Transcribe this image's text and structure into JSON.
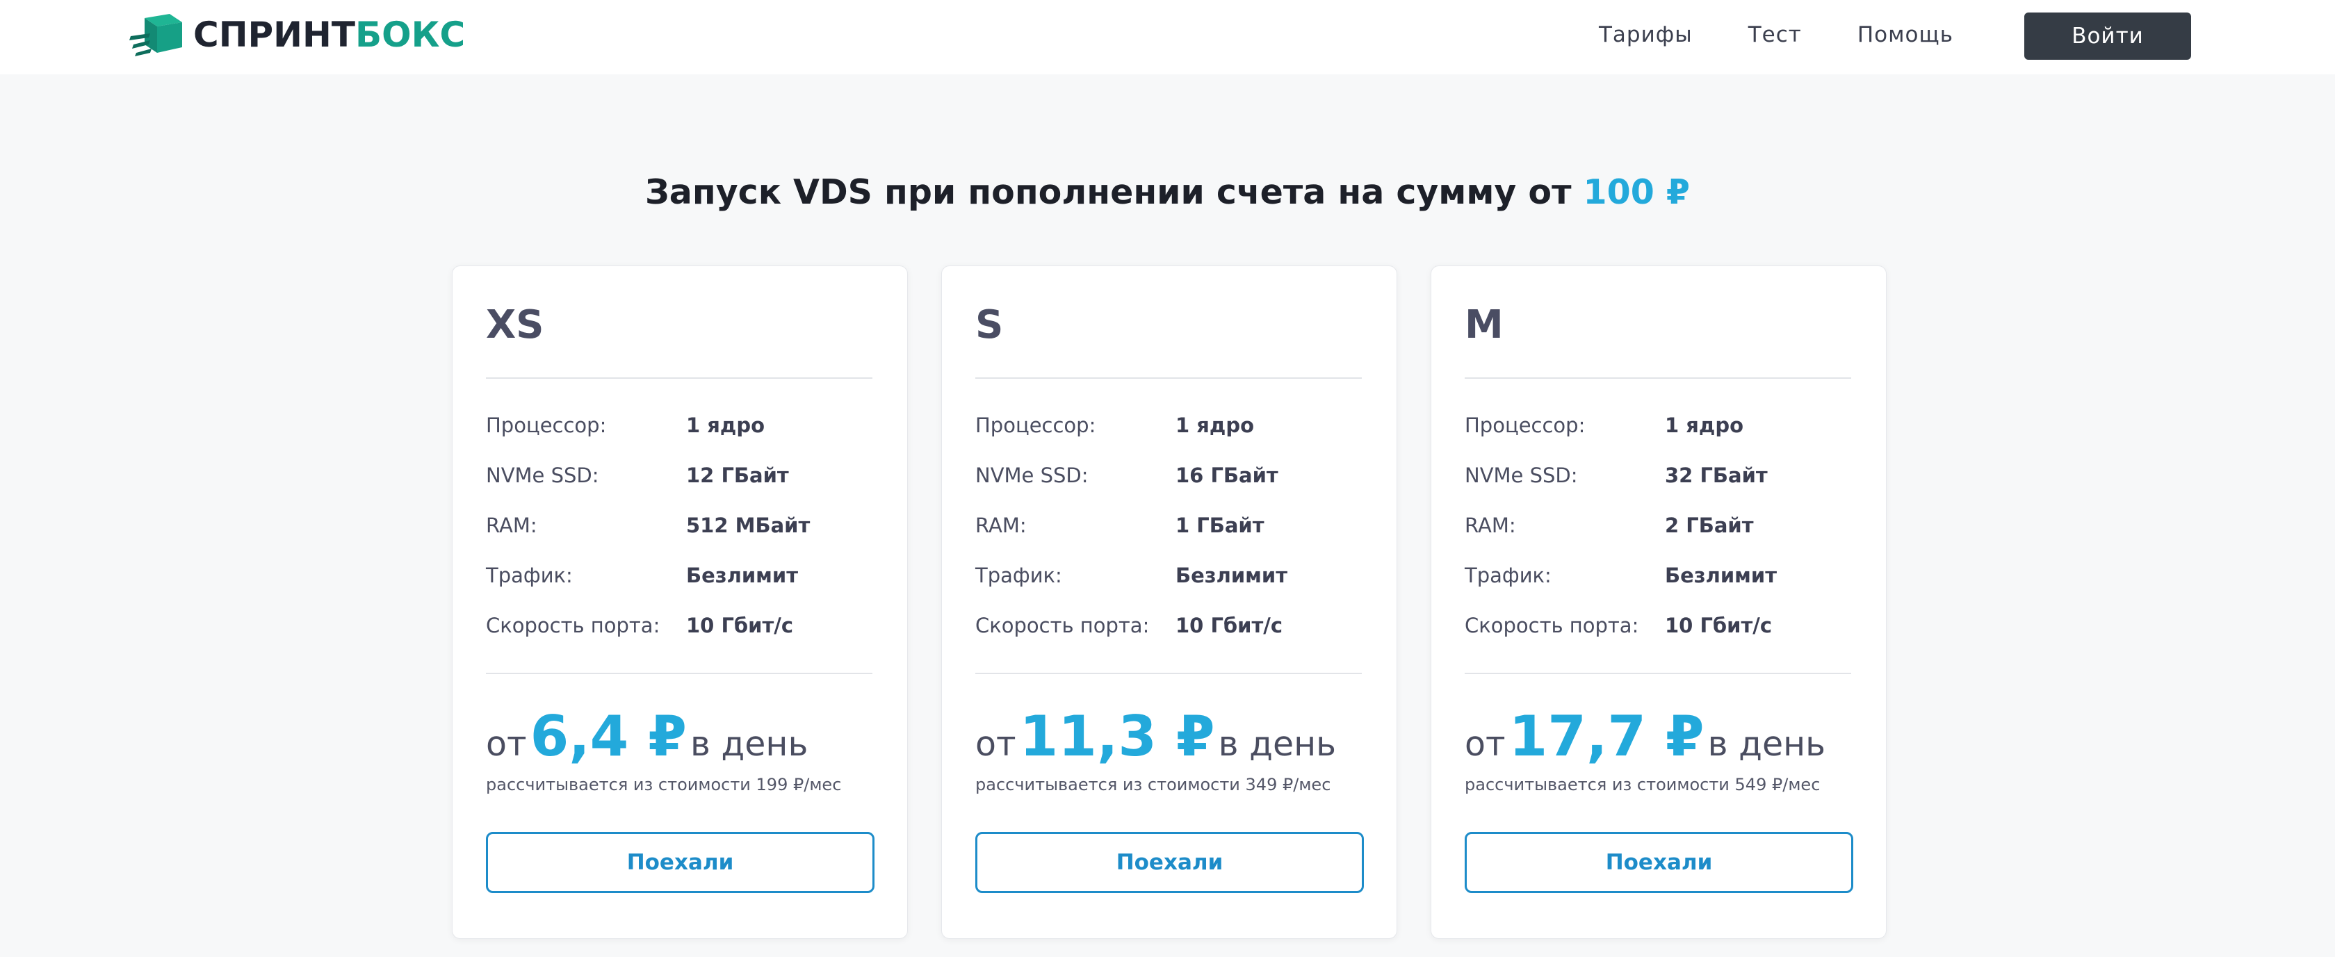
{
  "brand": {
    "name_part1": "СПРИНТ",
    "name_part2": "БОКС",
    "logo_icon": "box-arrow-logo-icon"
  },
  "nav": {
    "links": [
      "Тарифы",
      "Тест",
      "Помощь"
    ],
    "login_label": "Войти"
  },
  "headline": {
    "text": "Запуск VDS при пополнении счета на сумму от",
    "amount": "100 ₽"
  },
  "colors": {
    "accent": "#23a9db",
    "brand_green": "#15a08a",
    "button_dark": "#353c45",
    "button_outline": "#1d8cc9"
  },
  "plans": [
    {
      "name": "XS",
      "specs": [
        {
          "label": "Процессор:",
          "value": "1 ядро"
        },
        {
          "label": "NVMe SSD:",
          "value": "12 ГБайт"
        },
        {
          "label": "RAM:",
          "value": "512 МБайт"
        },
        {
          "label": "Трафик:",
          "value": "Безлимит"
        },
        {
          "label": "Скорость порта:",
          "value": "10 Гбит/с"
        }
      ],
      "price_prefix": "от",
      "price": "6,4 ₽",
      "price_suffix": "в день",
      "note": "рассчитывается из стоимости 199 ₽/мес",
      "button": "Поехали"
    },
    {
      "name": "S",
      "specs": [
        {
          "label": "Процессор:",
          "value": "1 ядро"
        },
        {
          "label": "NVMe SSD:",
          "value": "16 ГБайт"
        },
        {
          "label": "RAM:",
          "value": "1 ГБайт"
        },
        {
          "label": "Трафик:",
          "value": "Безлимит"
        },
        {
          "label": "Скорость порта:",
          "value": "10 Гбит/с"
        }
      ],
      "price_prefix": "от",
      "price": "11,3 ₽",
      "price_suffix": "в день",
      "note": "рассчитывается из стоимости 349 ₽/мес",
      "button": "Поехали"
    },
    {
      "name": "M",
      "specs": [
        {
          "label": "Процессор:",
          "value": "1 ядро"
        },
        {
          "label": "NVMe SSD:",
          "value": "32 ГБайт"
        },
        {
          "label": "RAM:",
          "value": "2 ГБайт"
        },
        {
          "label": "Трафик:",
          "value": "Безлимит"
        },
        {
          "label": "Скорость порта:",
          "value": "10 Гбит/с"
        }
      ],
      "price_prefix": "от",
      "price": "17,7 ₽",
      "price_suffix": "в день",
      "note": "рассчитывается из стоимости 549 ₽/мес",
      "button": "Поехали"
    }
  ]
}
